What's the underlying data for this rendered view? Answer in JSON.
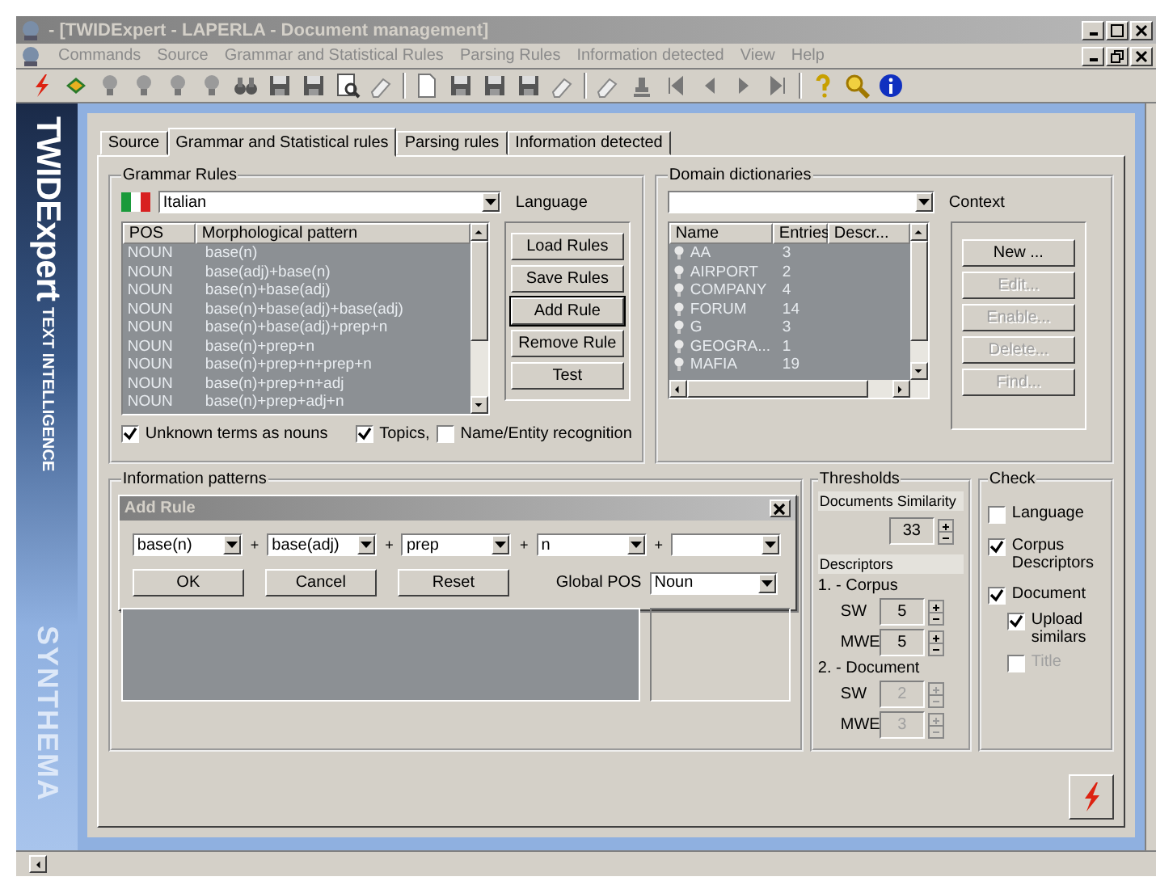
{
  "window": {
    "title": "- [TWIDExpert - LAPERLA - Document management]",
    "active": false
  },
  "menu": [
    {
      "label": "Commands",
      "disabled": true
    },
    {
      "label": "Source",
      "disabled": true
    },
    {
      "label": "Grammar and Statistical Rules",
      "disabled": true
    },
    {
      "label": "Parsing Rules",
      "disabled": true
    },
    {
      "label": "Information detected",
      "disabled": true
    },
    {
      "label": "View",
      "disabled": true
    },
    {
      "label": "Help",
      "disabled": true
    }
  ],
  "banner": {
    "product": "TWIDExpert",
    "tagline": "TEXT INTELLIGENCE",
    "vendor": "SYNTHEMA"
  },
  "tabs": [
    {
      "label": "Source",
      "selected": false
    },
    {
      "label": "Grammar and Statistical rules",
      "selected": true
    },
    {
      "label": "Parsing rules",
      "selected": false
    },
    {
      "label": "Information detected",
      "selected": false
    }
  ],
  "grammar_rules": {
    "title": "Grammar Rules",
    "language": "Italian",
    "language_label": "Language",
    "columns": [
      "POS",
      "Morphological pattern"
    ],
    "rows": [
      {
        "pos": "NOUN",
        "pattern": "base(n)"
      },
      {
        "pos": "NOUN",
        "pattern": "base(adj)+base(n)"
      },
      {
        "pos": "NOUN",
        "pattern": "base(n)+base(adj)"
      },
      {
        "pos": "NOUN",
        "pattern": "base(n)+base(adj)+base(adj)"
      },
      {
        "pos": "NOUN",
        "pattern": "base(n)+base(adj)+prep+n"
      },
      {
        "pos": "NOUN",
        "pattern": "base(n)+prep+n"
      },
      {
        "pos": "NOUN",
        "pattern": "base(n)+prep+n+prep+n"
      },
      {
        "pos": "NOUN",
        "pattern": "base(n)+prep+n+adj"
      },
      {
        "pos": "NOUN",
        "pattern": "base(n)+prep+adj+n"
      }
    ],
    "buttons": [
      {
        "label": "Load Rules",
        "default": false
      },
      {
        "label": "Save Rules",
        "default": false
      },
      {
        "label": "Add Rule",
        "default": true
      },
      {
        "label": "Remove Rule",
        "default": false
      },
      {
        "label": "Test",
        "default": false
      }
    ],
    "options": [
      {
        "label": "Unknown terms as nouns",
        "checked": true
      },
      {
        "label": "Topics,",
        "checked": true
      },
      {
        "label": "Name/Entity recognition",
        "checked": false
      }
    ]
  },
  "domain_dictionaries": {
    "title": "Domain dictionaries",
    "context_label": "Context",
    "columns": [
      "Name",
      "Entries",
      "Descr..."
    ],
    "rows": [
      {
        "name": "AA",
        "entries": "3"
      },
      {
        "name": "AIRPORT",
        "entries": "2"
      },
      {
        "name": "COMPANY",
        "entries": "4"
      },
      {
        "name": "FORUM",
        "entries": "14"
      },
      {
        "name": "G",
        "entries": "3"
      },
      {
        "name": "GEOGRA...",
        "entries": "1"
      },
      {
        "name": "MAFIA",
        "entries": "19"
      }
    ],
    "buttons": [
      {
        "label": "New ...",
        "disabled": false
      },
      {
        "label": "Edit...",
        "disabled": true
      },
      {
        "label": "Enable...",
        "disabled": true
      },
      {
        "label": "Delete...",
        "disabled": true
      },
      {
        "label": "Find...",
        "disabled": true
      }
    ]
  },
  "information_patterns": {
    "title": "Information patterns"
  },
  "add_rule": {
    "title": "Add Rule",
    "joiner": "+",
    "terms": [
      {
        "kind": "filled",
        "value": "base(n)"
      },
      {
        "kind": "filled",
        "value": "base(adj)"
      },
      {
        "kind": "filled",
        "value": "prep"
      },
      {
        "kind": "filled",
        "value": "n"
      },
      {
        "kind": "blank"
      }
    ],
    "buttons": [
      "OK",
      "Cancel",
      "Reset"
    ],
    "global_pos_label": "Global POS",
    "global_pos": "Noun"
  },
  "thresholds": {
    "title": "Thresholds",
    "similarity_label": "Documents Similarity",
    "similarity": "33",
    "descriptors_label": "Descriptors",
    "sections": [
      {
        "label": "1. - Corpus",
        "fields": [
          {
            "label": "SW",
            "value": "5",
            "disabled": false
          },
          {
            "label": "MWE",
            "value": "5",
            "disabled": false
          }
        ]
      },
      {
        "label": "2. - Document",
        "fields": [
          {
            "label": "SW",
            "value": "2",
            "disabled": true
          },
          {
            "label": "MWE",
            "value": "3",
            "disabled": true
          }
        ]
      }
    ]
  },
  "check": {
    "title": "Check",
    "items": [
      {
        "label": "Language",
        "checked": false,
        "disabled": false
      },
      {
        "label": "Corpus Descriptors",
        "checked": true,
        "disabled": false
      },
      {
        "label": "Document",
        "checked": true,
        "disabled": false,
        "children": [
          {
            "label": "Upload similars",
            "checked": true,
            "disabled": false
          },
          {
            "label": "Title",
            "checked": false,
            "disabled": true
          }
        ]
      }
    ]
  }
}
